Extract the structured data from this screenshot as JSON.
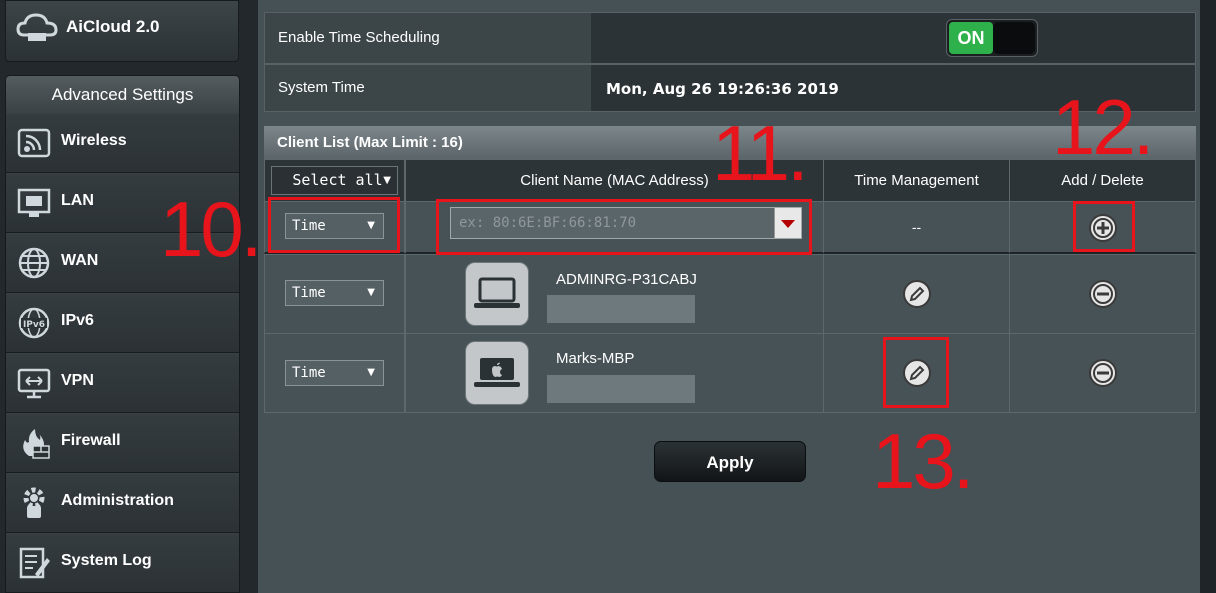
{
  "sidebar": {
    "aicloud_label": "AiCloud 2.0",
    "section_title": "Advanced Settings",
    "items": [
      {
        "label": "Wireless",
        "icon": "wireless-icon"
      },
      {
        "label": "LAN",
        "icon": "lan-icon"
      },
      {
        "label": "WAN",
        "icon": "wan-globe-icon"
      },
      {
        "label": "IPv6",
        "icon": "ipv6-globe-icon"
      },
      {
        "label": "VPN",
        "icon": "vpn-monitor-icon"
      },
      {
        "label": "Firewall",
        "icon": "firewall-icon"
      },
      {
        "label": "Administration",
        "icon": "administration-gear-icon"
      },
      {
        "label": "System Log",
        "icon": "system-log-icon"
      }
    ]
  },
  "settings": {
    "time_scheduling_label": "Enable Time Scheduling",
    "time_scheduling_toggle": "ON",
    "system_time_label": "System Time",
    "system_time_value": "Mon, Aug 26 19:26:36 2019"
  },
  "client_list": {
    "title": "Client List (Max Limit : 16)",
    "select_all": "Select all",
    "columns": [
      "Client Name (MAC Address)",
      "Time Management",
      "Add / Delete"
    ],
    "new_row": {
      "type": "Time",
      "mac_placeholder": "ex: 80:6E:BF:66:81:70",
      "time_management": "--"
    },
    "clients": [
      {
        "type": "Time",
        "name": "ADMINRG-P31CABJ",
        "device_icon": "laptop-icon"
      },
      {
        "type": "Time",
        "name": "Marks-MBP",
        "device_icon": "apple-laptop-icon"
      }
    ]
  },
  "apply_label": "Apply",
  "annotations": [
    "10.",
    "11.",
    "12.",
    "13."
  ],
  "colors": {
    "annotation": "#e8141c",
    "toggle_on": "#2eb14a",
    "dropdown_arrow": "#b40000"
  }
}
